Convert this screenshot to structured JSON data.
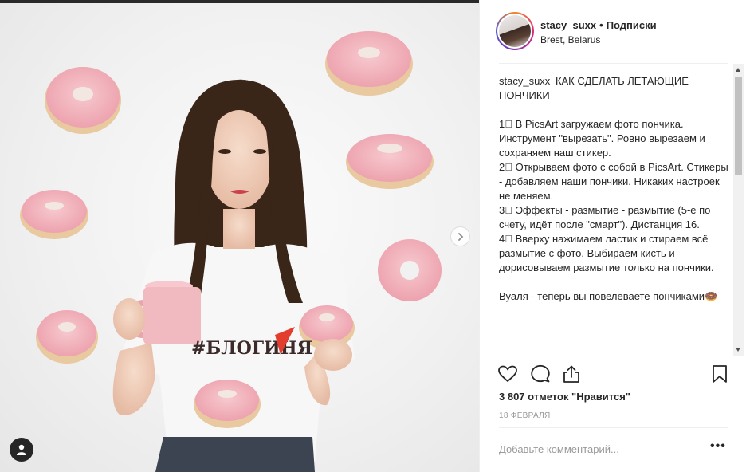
{
  "post": {
    "username": "stacy_suxx",
    "separator": "•",
    "follow_label": "Подписки",
    "location": "Brest, Belarus",
    "caption_title": "КАК СДЕЛАТЬ ЛЕТАЮЩИЕ ПОНЧИКИ",
    "caption_body": "1⃣ В PicsArt загружаем фото пончика. Инструмент \"вырезать\". Ровно вырезаем и сохраняем наш стикер.\n2⃣ Открываем фото с собой в PicsArt. Стикеры - добавляем наши пончики. Никаких настроек не меняем.\n3⃣ Эффекты - размытие - размытие (5-е по счету, идёт после \"смарт\"). Дистанция 16.\n4⃣ Вверху нажимаем ластик и стираем всё размытие с фото. Выбираем кисть и дорисовываем размытие только на пончики.\n\nВуаля - теперь вы повелеваете пончиками🍩",
    "likes": "3 807 отметок \"Нравится\"",
    "date": "18 ФЕВРАЛЯ",
    "comment_placeholder": "Добавьте комментарий...",
    "more_label": "•••"
  },
  "photo": {
    "shirt_text": "#БЛОГИНЯ",
    "colors": {
      "donut_glaze": "#f2b8c0",
      "donut_dough": "#e8c9a0",
      "mug": "#f1b9c0",
      "hair": "#3a2519",
      "shirt": "#f7f7f7"
    }
  },
  "icons": [
    "heart-icon",
    "comment-icon",
    "share-icon",
    "bookmark-icon",
    "chevron-right-icon",
    "user-tag-icon",
    "more-icon"
  ]
}
